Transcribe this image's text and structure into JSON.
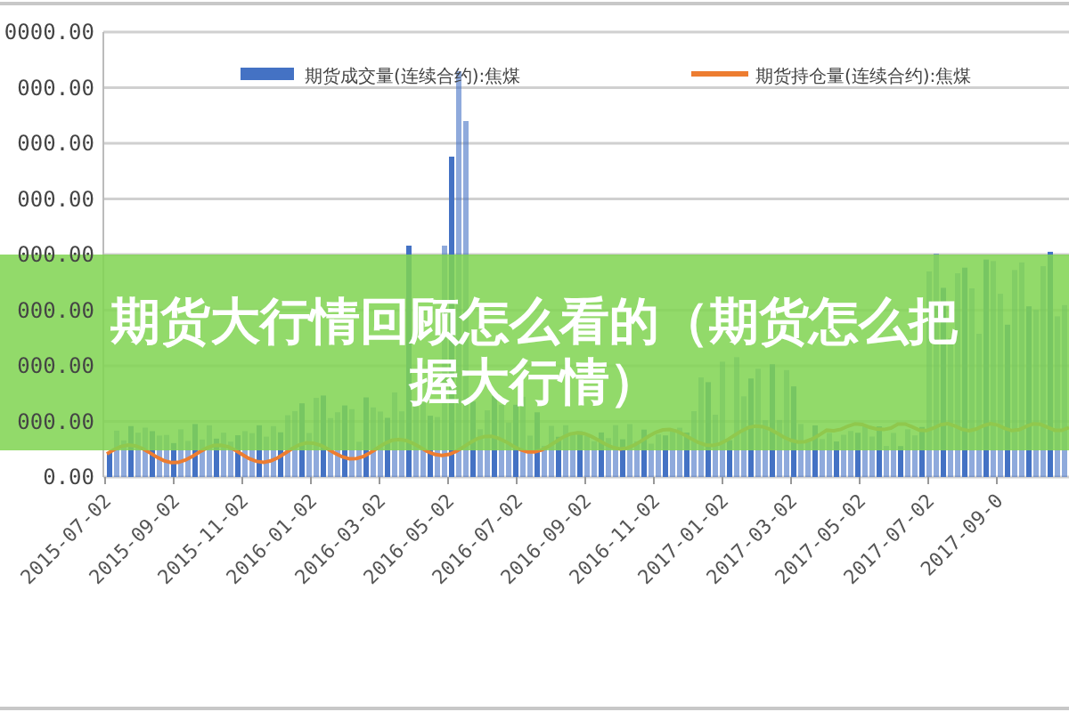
{
  "chart": {
    "legend": [
      {
        "label": "期货成交量(连续合约):焦煤",
        "kind": "bar",
        "color": "#4472c4"
      },
      {
        "label": "期货持仓量(连续合约):焦煤",
        "kind": "line",
        "color": "#ed7d31"
      }
    ],
    "yticks": [
      "0000.00",
      "000.00",
      "000.00",
      "000.00",
      "000.00",
      "000.00",
      "000.00",
      "000.00",
      "0.00"
    ],
    "xticks": [
      "2015-07-02",
      "2015-09-02",
      "2015-11-02",
      "2016-01-02",
      "2016-03-02",
      "2016-05-02",
      "2016-07-02",
      "2016-09-02",
      "2016-11-02",
      "2017-01-02",
      "2017-03-02",
      "2017-05-02",
      "2017-07-02",
      "2017-09-0"
    ]
  },
  "banner": {
    "title": "期货大行情回顾怎么看的（期货怎么把握大行情）"
  }
}
